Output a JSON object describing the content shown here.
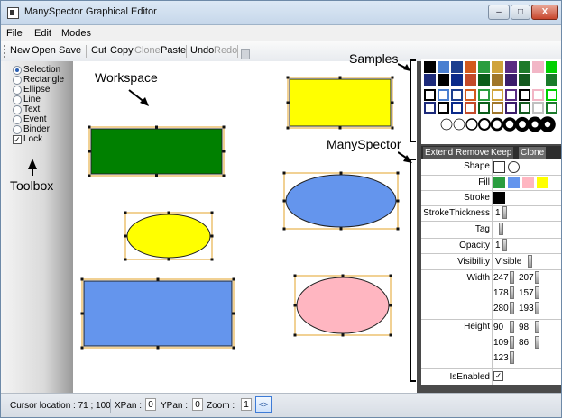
{
  "window": {
    "title": "ManySpector Graphical Editor",
    "minimize_glyph": "–",
    "maximize_glyph": "□",
    "close_glyph": "X"
  },
  "menu": [
    "File",
    "Edit",
    "Modes"
  ],
  "toolbar": {
    "new": "New",
    "open": "Open",
    "save": "Save",
    "cut": "Cut",
    "copy": "Copy",
    "clone": "Clone",
    "paste": "Paste",
    "undo": "Undo",
    "redo": "Redo"
  },
  "toolbox": {
    "modes": [
      "Selection",
      "Rectangle",
      "Ellipse",
      "Line",
      "Text",
      "Event",
      "Binder"
    ],
    "selected_mode": "Selection",
    "lock_label": "Lock",
    "lock_checked": true
  },
  "annotations": {
    "workspace": "Workspace",
    "samples": "Samples",
    "manyspector": "ManySpector",
    "toolbox": "Toolbox"
  },
  "workspace_shapes": [
    {
      "kind": "rectangle",
      "fill": "#ffff00",
      "selected": true
    },
    {
      "kind": "rectangle",
      "fill": "#008000",
      "selected": true
    },
    {
      "kind": "ellipse",
      "fill": "#ffff00",
      "selected": true
    },
    {
      "kind": "ellipse",
      "fill": "#6495ed",
      "selected": true
    },
    {
      "kind": "rectangle",
      "fill": "#6495ed",
      "selected": true
    },
    {
      "kind": "ellipse",
      "fill": "#ffb6c1",
      "selected": true
    }
  ],
  "samples": {
    "fill_colors": [
      "#000000",
      "#4a7fd0",
      "#1c3f8f",
      "#d25a1d",
      "#2a9d3f",
      "#d0a33b",
      "#5a2c82",
      "#1e7a2a",
      "#f2b6c6",
      "#00d000"
    ],
    "fill_colors_row2": [
      "#1c2a7a",
      "#000000",
      "#0a2a8a",
      "#c24a2a",
      "#0b5d1a",
      "#a0762a",
      "#3a1d6a",
      "#145a1f",
      "#ffffff",
      "#1a7a2a"
    ],
    "outline_colors": [
      "#000000",
      "#4a7fd0",
      "#1c3f8f",
      "#d25a1d",
      "#2a9d3f",
      "#d0a33b",
      "#5a2c82",
      "#000000",
      "#f2b6c6",
      "#00d000"
    ],
    "outline_colors_row2": [
      "#1c2a7a",
      "#000000",
      "#0a2a8a",
      "#c24a2a",
      "#0b5d1a",
      "#a0762a",
      "#3a1d6a",
      "#145a1f",
      "#c0c0c0",
      "#1a7a2a"
    ],
    "stroke_thicknesses": [
      1,
      1,
      2,
      3,
      4,
      5,
      6,
      7,
      8
    ]
  },
  "inspector": {
    "buttons": {
      "extend": "Extend",
      "remove": "Remove",
      "keep": "Keep",
      "clone": "Clone"
    },
    "rows": {
      "shape": "Shape",
      "fill": "Fill",
      "stroke": "Stroke",
      "stroke_thickness": "StrokeThickness",
      "tag": "Tag",
      "opacity": "Opacity",
      "visibility": "Visibility",
      "width": "Width",
      "height": "Height",
      "is_enabled": "IsEnabled"
    },
    "values": {
      "fill_colors": [
        "#2a9d3f",
        "#6495ed",
        "#ffb6c1",
        "#ffff00"
      ],
      "stroke_color": "#000000",
      "stroke_thickness": "1",
      "tag": "",
      "opacity": "1",
      "visibility": "Visible",
      "widths": [
        "247",
        "207",
        "178",
        "157",
        "280",
        "193"
      ],
      "heights": [
        "90",
        "98",
        "109",
        "86",
        "123"
      ],
      "is_enabled": true
    }
  },
  "status": {
    "cursor_label": "Cursor location : 71 ; 100",
    "xpan_label": "XPan :",
    "xpan_value": "0",
    "ypan_label": "YPan :",
    "ypan_value": "0",
    "zoom_label": "Zoom :",
    "zoom_value": "1",
    "toggle_label": "<>"
  }
}
